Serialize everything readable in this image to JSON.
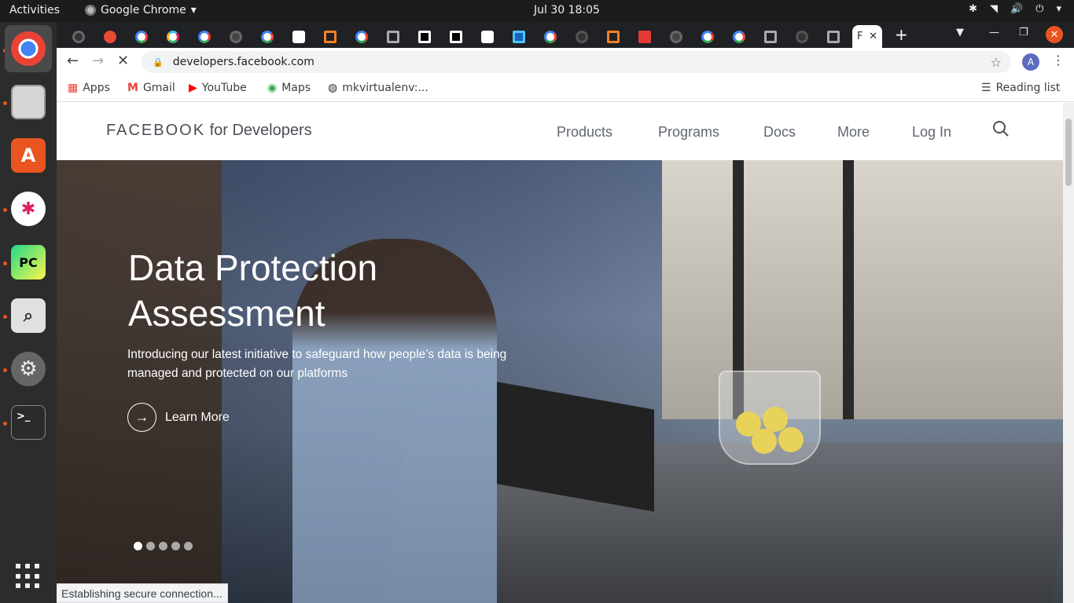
{
  "topbar": {
    "activities": "Activities",
    "app_name": "Google Chrome",
    "clock": "Jul 30  18:05"
  },
  "dock": {
    "apps": [
      "chrome",
      "files",
      "software-center",
      "slack",
      "pycharm",
      "image-viewer",
      "settings",
      "terminal"
    ]
  },
  "browser": {
    "active_tab_letter": "F",
    "url": "developers.facebook.com",
    "profile_initial": "A",
    "bookmarks": [
      {
        "label": "Apps",
        "icon": "apps-grid-icon"
      },
      {
        "label": "Gmail",
        "icon": "gmail-icon"
      },
      {
        "label": "YouTube",
        "icon": "youtube-icon"
      },
      {
        "label": "Maps",
        "icon": "maps-icon"
      },
      {
        "label": "mkvirtualenv:...",
        "icon": "globe-icon"
      }
    ],
    "reading_list": "Reading list",
    "status": "Establishing secure connection..."
  },
  "site": {
    "logo_brand": "FACEBOOK",
    "logo_suffix": "for Developers",
    "nav": [
      "Products",
      "Programs",
      "Docs",
      "More",
      "Log In"
    ],
    "hero": {
      "title_line1": "Data Protection",
      "title_line2": "Assessment",
      "subtitle": "Introducing our latest initiative to safeguard how people’s data is being managed and protected on our platforms",
      "cta": "Learn More",
      "slides": 5,
      "active_slide": 1
    }
  },
  "colors": {
    "accent_ubuntu": "#e95420",
    "chrome_dark": "#202124",
    "fb_nav_text": "#606770"
  }
}
